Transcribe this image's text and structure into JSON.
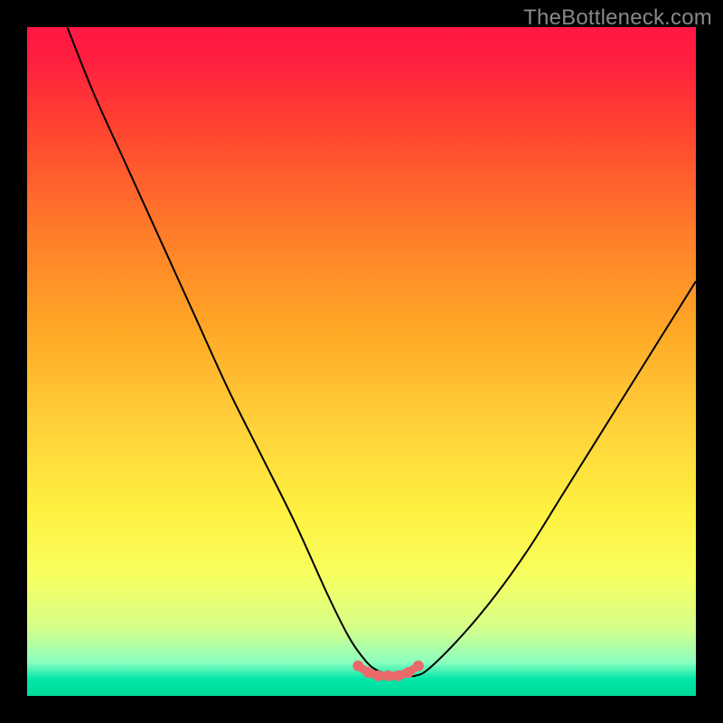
{
  "watermark": "TheBottleneck.com",
  "colors": {
    "frame": "#000000",
    "curve": "#000000",
    "marker_fill": "#ea6a6a",
    "marker_stroke": "#ea6a6a",
    "gradient_stops": [
      {
        "offset": 0.0,
        "color": "#ff1744"
      },
      {
        "offset": 0.05,
        "color": "#ff1f3f"
      },
      {
        "offset": 0.15,
        "color": "#ff4330"
      },
      {
        "offset": 0.3,
        "color": "#ff7a2a"
      },
      {
        "offset": 0.45,
        "color": "#ffa726"
      },
      {
        "offset": 0.6,
        "color": "#ffd23a"
      },
      {
        "offset": 0.72,
        "color": "#fff040"
      },
      {
        "offset": 0.82,
        "color": "#f8ff60"
      },
      {
        "offset": 0.9,
        "color": "#d4ff8a"
      },
      {
        "offset": 0.95,
        "color": "#8affc0"
      },
      {
        "offset": 0.975,
        "color": "#00e6a8"
      },
      {
        "offset": 1.0,
        "color": "#00db9a"
      }
    ]
  },
  "chart_data": {
    "type": "line",
    "title": "",
    "xlabel": "",
    "ylabel": "",
    "xlim": [
      0,
      100
    ],
    "ylim": [
      0,
      100
    ],
    "series": [
      {
        "name": "bottleneck-curve",
        "x": [
          6,
          10,
          15,
          20,
          25,
          30,
          35,
          40,
          45,
          48,
          50,
          52,
          55,
          57,
          58,
          60,
          65,
          70,
          75,
          80,
          85,
          90,
          95,
          100
        ],
        "y": [
          100,
          90,
          79,
          68,
          57,
          46,
          36,
          26,
          15,
          9,
          6,
          4,
          3,
          3,
          3,
          4,
          9,
          15,
          22,
          30,
          38,
          46,
          54,
          62
        ]
      },
      {
        "name": "sweet-spot-markers",
        "x": [
          49.5,
          51.0,
          52.5,
          54.0,
          55.5,
          57.0,
          58.5
        ],
        "y": [
          4.5,
          3.5,
          3.0,
          3.0,
          3.0,
          3.5,
          4.5
        ]
      }
    ],
    "annotations": []
  }
}
